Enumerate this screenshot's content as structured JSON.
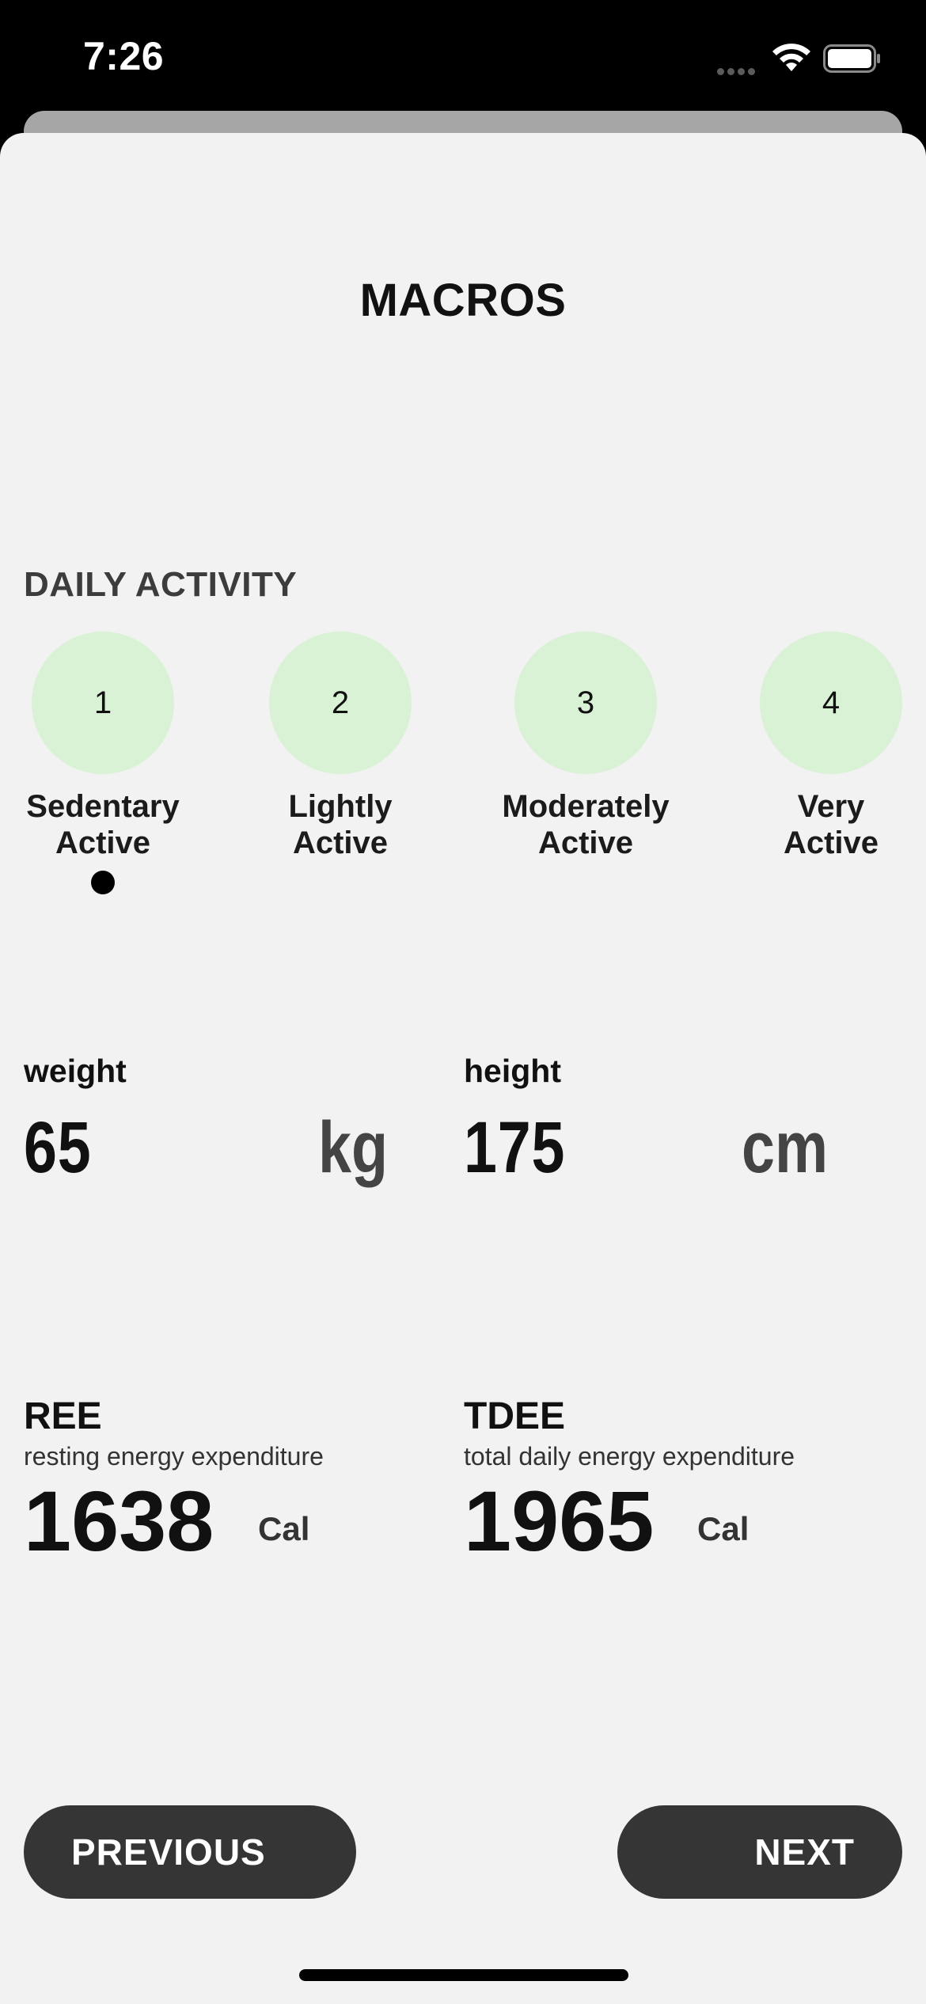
{
  "status_bar": {
    "time": "7:26",
    "icons": [
      "signal-dots-icon",
      "wifi-icon",
      "battery-icon"
    ]
  },
  "title": "MACROS",
  "daily_activity": {
    "heading": "DAILY ACTIVITY",
    "selected_index": 0,
    "options": [
      {
        "number": "1",
        "label_line1": "Sedentary",
        "label_line2": "Active"
      },
      {
        "number": "2",
        "label_line1": "Lightly",
        "label_line2": "Active"
      },
      {
        "number": "3",
        "label_line1": "Moderately",
        "label_line2": "Active"
      },
      {
        "number": "4",
        "label_line1": "Very",
        "label_line2": "Active"
      }
    ]
  },
  "measurements": {
    "weight": {
      "label": "weight",
      "value": "65",
      "unit": "kg"
    },
    "height": {
      "label": "height",
      "value": "175",
      "unit": "cm"
    }
  },
  "energy": {
    "ree": {
      "title": "REE",
      "subtitle": "resting energy expenditure",
      "value": "1638",
      "unit": "Cal"
    },
    "tdee": {
      "title": "TDEE",
      "subtitle": "total daily energy expenditure",
      "value": "1965",
      "unit": "Cal"
    }
  },
  "buttons": {
    "previous": "PREVIOUS",
    "next": "NEXT"
  },
  "colors": {
    "activity_circle": "#d9f2d5",
    "sheet_background": "#f2f2f2",
    "button_background": "#353535"
  }
}
